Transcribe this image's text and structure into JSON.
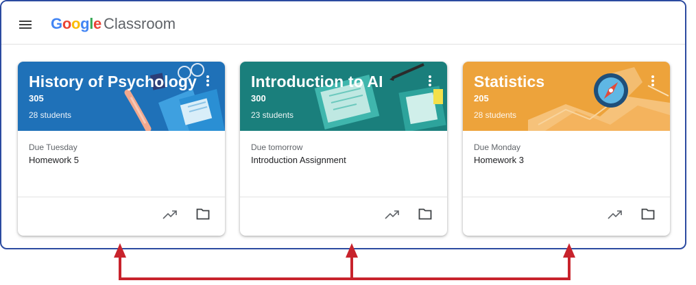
{
  "app": {
    "brand_google": [
      "G",
      "o",
      "o",
      "g",
      "l",
      "e"
    ],
    "brand_product": "Classroom"
  },
  "colors": {
    "frame_border": "#2b4aa0",
    "arrow": "#c8232c",
    "google_blue": "#4285f4",
    "google_red": "#ea4335",
    "google_yellow": "#fbbc05",
    "google_green": "#34a853"
  },
  "classes": [
    {
      "title": "History of Psychology",
      "section": "305",
      "students": "28 students",
      "due_label": "Due Tuesday",
      "assignment": "Homework 5",
      "header_color": "#1f71b8"
    },
    {
      "title": "Introduction to AI",
      "section": "300",
      "students": "23 students",
      "due_label": "Due tomorrow",
      "assignment": "Introduction Assignment",
      "header_color": "#1a7f7c"
    },
    {
      "title": "Statistics",
      "section": "205",
      "students": "28 students",
      "due_label": "Due Monday",
      "assignment": "Homework 3",
      "header_color": "#eda33b"
    }
  ],
  "icons": {
    "menu": "hamburger-menu-icon",
    "more": "more-vert-icon",
    "trend": "trending-up-icon",
    "folder": "folder-icon"
  }
}
